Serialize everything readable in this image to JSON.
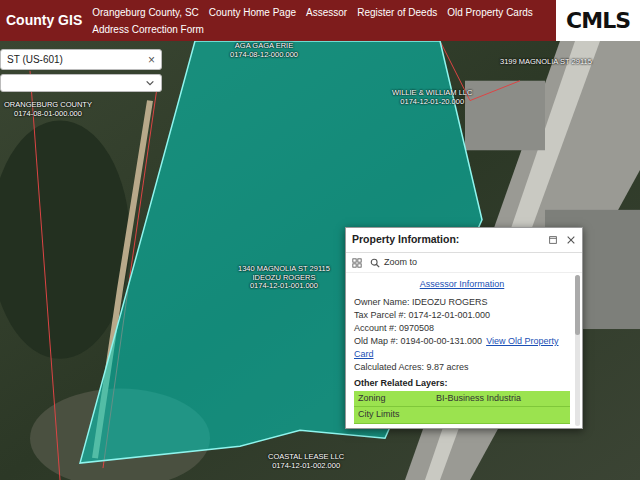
{
  "header": {
    "title": "County GIS",
    "links": [
      "Orangeburg County, SC",
      "County Home Page",
      "Assessor",
      "Register of Deeds",
      "Old Property Cards",
      "Address Correction Form"
    ]
  },
  "logo": {
    "text": "CMLS"
  },
  "search": {
    "value": "ST (US-601)",
    "clear": "×"
  },
  "map_labels": [
    {
      "lines": [
        "AGA GAGA ERIE",
        "0174-08-12-000.000"
      ]
    },
    {
      "lines": [
        "3199 MAGNOLIA ST 29115"
      ]
    },
    {
      "lines": [
        "WILLIE & WILLIAM LLC",
        "0174-12-01-20.000"
      ]
    },
    {
      "lines": [
        "ORANGEBURG COUNTY",
        "0174-08-01-000.000"
      ]
    },
    {
      "lines": [
        "1340 MAGNOLIA ST 29115",
        "IDEOZU ROGERS",
        "0174-12-01-001.000"
      ]
    },
    {
      "lines": [
        "COASTAL LEASE LLC",
        "0174-12-01-002.000"
      ]
    }
  ],
  "popup": {
    "title": "Property Information:",
    "zoom": "Zoom to",
    "assessor_link": "Assessor Information",
    "fields": [
      {
        "label": "Owner Name:",
        "value": "IDEOZU ROGERS"
      },
      {
        "label": "Tax Parcel #:",
        "value": "0174-12-01-001.000"
      },
      {
        "label": "Account #:",
        "value": "0970508"
      },
      {
        "label": "Old Map #:",
        "value": "0194-00-00-131.000",
        "link": "View Old Property Card"
      },
      {
        "label": "Calculated Acres:",
        "value": "9.87 acres"
      }
    ],
    "other_title": "Other Related Layers:",
    "layers": [
      {
        "label": "Zoning",
        "value": "BI-Business Industria"
      },
      {
        "label": "City Limits",
        "value": ""
      }
    ]
  }
}
